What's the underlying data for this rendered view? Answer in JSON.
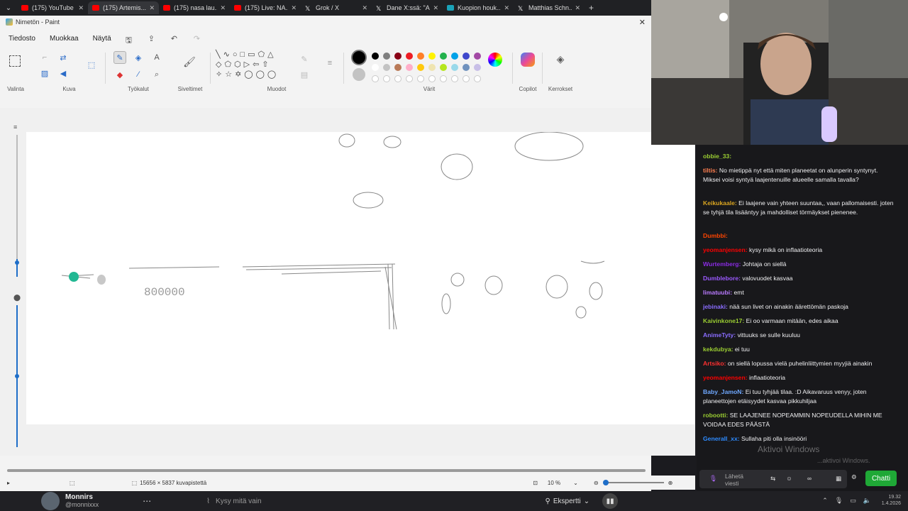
{
  "browser": {
    "tabs": [
      {
        "label": "(175) YouTube",
        "color": "#ff0000"
      },
      {
        "label": "(175) Artemis...",
        "color": "#ff0000"
      },
      {
        "label": "(175) nasa lau...",
        "color": "#ff0000"
      },
      {
        "label": "(175) Live: NA...",
        "color": "#ff0000"
      },
      {
        "label": "Grok / X",
        "color": "#ffffff"
      },
      {
        "label": "Dane X:ssä: \"A...",
        "color": "#ffffff"
      },
      {
        "label": "Kuopion houk...",
        "color": "#1aa2b8"
      },
      {
        "label": "Matthias Schn...",
        "color": "#ffffff"
      }
    ],
    "new_tab": "+"
  },
  "paint": {
    "title": "Nimetön - Paint",
    "menu": {
      "file": "Tiedosto",
      "edit": "Muokkaa",
      "view": "Näytä"
    },
    "groups": {
      "selection": "Valinta",
      "image": "Kuva",
      "tools": "Työkalut",
      "brushes": "Siveltimet",
      "shapes": "Muodot",
      "colors": "Värit",
      "copilot": "Copilot",
      "layers": "Kerrokset"
    },
    "palette_row1": [
      "#000000",
      "#7f7f7f",
      "#880015",
      "#ed1c24",
      "#ff7f27",
      "#fff200",
      "#22b14c",
      "#00a2e8",
      "#3f48cc",
      "#a349a4"
    ],
    "palette_row2": [
      "#ffffff",
      "#c3c3c3",
      "#b97a57",
      "#ffaec9",
      "#ffc90e",
      "#efe4b0",
      "#b5e61d",
      "#99d9ea",
      "#7092be",
      "#c8bfe7"
    ],
    "canvas_text": "800000",
    "status": {
      "size": "15656 × 5837 kuvapistettä",
      "zoom": "10 %"
    }
  },
  "chat": {
    "messages": [
      {
        "user": "obbie_33:",
        "color": "#9acd32",
        "text": ""
      },
      {
        "user": "tiltis:",
        "color": "#ff7f50",
        "text": "No mietippä nyt että miten planeetat on alunperin syntynyt. Miksei voisi syntyä laajentenuille alueelle samalla tavalla?"
      },
      {
        "user": "Keikukaale:",
        "color": "#daa520",
        "text": "Ei laajene vain yhteen suuntaa,, vaan pallomaisesti. joten se tyhjä tila lisääntyy ja mahdolliset törmäykset pienenee."
      },
      {
        "user": "Dumbbi:",
        "color": "#ff4500",
        "text": ""
      },
      {
        "user": "yeomanjensen:",
        "color": "#ff0000",
        "text": "kysy mikä on inflaatioteoria"
      },
      {
        "user": "Wurtemberg:",
        "color": "#8a2be2",
        "text": "Johtaja on siellä"
      },
      {
        "user": "Dumblebore:",
        "color": "#9b59ff",
        "text": "valovuodet kasvaa"
      },
      {
        "user": "limatuubi:",
        "color": "#b97aff",
        "text": "emt"
      },
      {
        "user": "jebinaki:",
        "color": "#8a6dff",
        "text": "nää sun livet on ainakin äärettömän paskoja"
      },
      {
        "user": "Kaivinkone17:",
        "color": "#9acd32",
        "text": "Ei oo varmaan mitään, edes aikaa"
      },
      {
        "user": "AnimeTyty:",
        "color": "#8a6dff",
        "text": "vittuuks se sulle kuuluu"
      },
      {
        "user": "kekdubya:",
        "color": "#9acd32",
        "text": "ei tuu"
      },
      {
        "user": "Artsiko:",
        "color": "#ff3030",
        "text": "on siellä lopussa vielä puhelinliittymien myyjiä ainakin"
      },
      {
        "user": "yeomanjensen:",
        "color": "#ff0000",
        "text": "inflaatioteoria"
      },
      {
        "user": "Baby_JamoN:",
        "color": "#6fa8ff",
        "text": "Ei tuu tyhjää tilaa. :D Aikavaruus venyy, joten planeettojen etäisyydet kasvaa pikkuhiljaa"
      },
      {
        "user": "robootti:",
        "color": "#9acd32",
        "text": "SE LAAJENEE NOPEAMMIN NOPEUDELLA MIHIN ME VOIDAA EDES PÄÄSTÄ"
      },
      {
        "user": "Generall_xx:",
        "color": "#2e8bff",
        "text": "Sullaha piti olla insinööri"
      }
    ],
    "input_placeholder": "Lähetä viesti",
    "send_button": "Chatti",
    "watermark": "Aktivoi Windows",
    "watermark_sub": "...aktivoi Windows."
  },
  "taskbar": {
    "user_name": "Monnirs",
    "user_handle": "@monnixxx",
    "ask_placeholder": "Kysy mitä vain",
    "mode": "Ekspertti",
    "time": "19.32",
    "date": "1.4.2026"
  }
}
